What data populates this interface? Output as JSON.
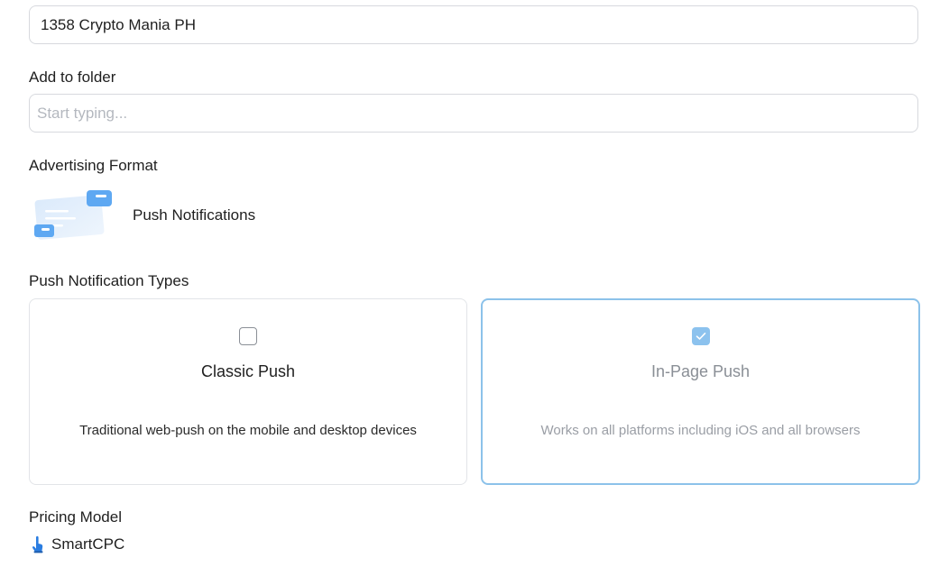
{
  "campaign": {
    "name_value": "1358 Crypto Mania PH"
  },
  "folder": {
    "label": "Add to folder",
    "placeholder": "Start typing..."
  },
  "format": {
    "label": "Advertising Format",
    "selected": "Push Notifications",
    "icon": "push-notification-illustration"
  },
  "notification_types": {
    "label": "Push Notification Types",
    "options": [
      {
        "title": "Classic Push",
        "description": "Traditional web-push on the mobile and desktop devices",
        "checked": false
      },
      {
        "title": "In-Page Push",
        "description": "Works on all platforms including iOS and all browsers",
        "checked": true
      }
    ]
  },
  "pricing": {
    "label": "Pricing Model",
    "value": "SmartCPC",
    "icon": "pointer-hand-icon"
  },
  "colors": {
    "accent": "#8cc2ea",
    "illustration_blue": "#5ea8f2",
    "text": "#1f1f1f",
    "muted": "#8a8f96"
  }
}
